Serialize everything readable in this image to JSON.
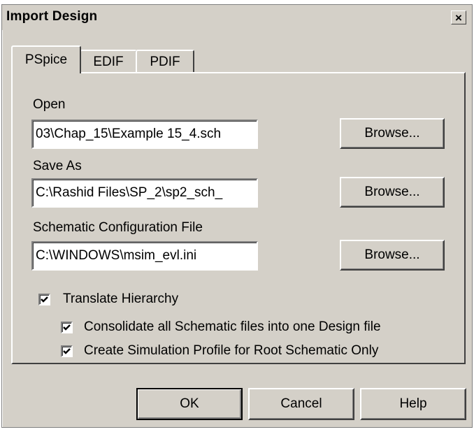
{
  "window": {
    "title": "Import Design",
    "close_glyph": "×"
  },
  "tabs": [
    {
      "label": "PSpice",
      "active": true
    },
    {
      "label": "EDIF",
      "active": false
    },
    {
      "label": "PDIF",
      "active": false
    }
  ],
  "open": {
    "label": "Open",
    "value": "03\\Chap_15\\Example 15_4.sch",
    "browse_label": "Browse..."
  },
  "save_as": {
    "label": "Save As",
    "value": "C:\\Rashid Files\\SP_2\\sp2_sch_",
    "browse_label": "Browse..."
  },
  "config": {
    "label": "Schematic Configuration File",
    "value": "C:\\WINDOWS\\msim_evl.ini",
    "browse_label": "Browse..."
  },
  "options": {
    "translate_hierarchy": {
      "label": "Translate Hierarchy",
      "checked": true
    },
    "consolidate": {
      "label": "Consolidate all Schematic files into one Design file",
      "checked": true
    },
    "create_profile": {
      "label": "Create Simulation Profile for Root Schematic Only",
      "checked": true
    }
  },
  "buttons": {
    "ok": "OK",
    "cancel": "Cancel",
    "help": "Help"
  }
}
